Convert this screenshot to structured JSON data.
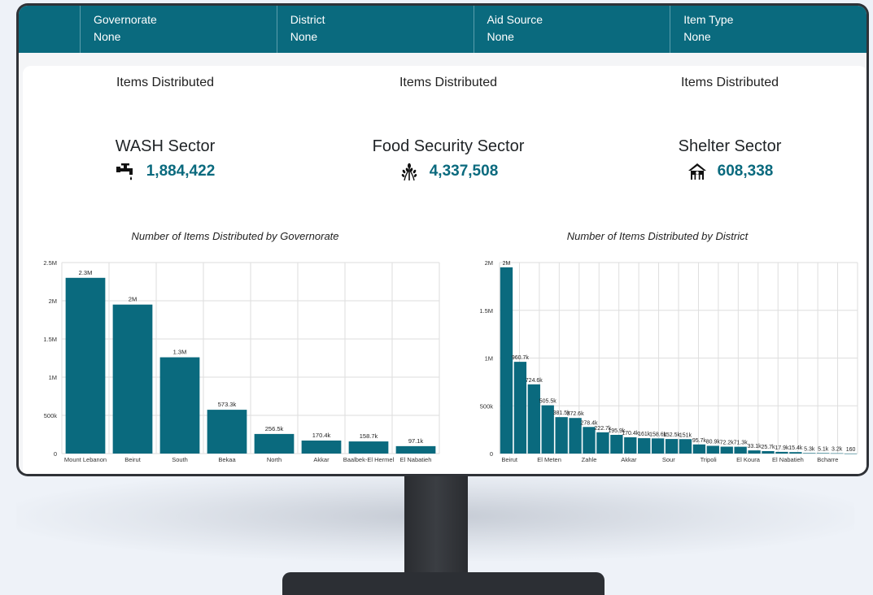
{
  "filters": [
    {
      "label": "Governorate",
      "value": "None"
    },
    {
      "label": "District",
      "value": "None"
    },
    {
      "label": "Aid Source",
      "value": "None"
    },
    {
      "label": "Item Type",
      "value": "None"
    }
  ],
  "kpis": [
    {
      "caption": "Items Distributed",
      "sector": "WASH Sector",
      "value": "1,884,422",
      "icon": "water-tap-icon"
    },
    {
      "caption": "Items Distributed",
      "sector": "Food Security Sector",
      "value": "4,337,508",
      "icon": "wheat-icon"
    },
    {
      "caption": "Items Distributed",
      "sector": "Shelter Sector",
      "value": "608,338",
      "icon": "shelter-house-icon"
    }
  ],
  "colors": {
    "accent": "#0a6a7e",
    "bar": "#0a6a7e"
  },
  "chart_data": [
    {
      "type": "bar",
      "title": "Number of Items Distributed by Governorate",
      "categories": [
        "Mount Lebanon",
        "Beirut",
        "South",
        "Bekaa",
        "North",
        "Akkar",
        "Baalbek-El Hermel",
        "El Nabatieh"
      ],
      "values": [
        2300000,
        1950000,
        1260000,
        573300,
        256500,
        170400,
        158700,
        97100
      ],
      "data_labels": [
        "2.3M",
        "2M",
        "1.3M",
        "573.3k",
        "256.5k",
        "170.4k",
        "158.7k",
        "97.1k"
      ],
      "yticks": [
        "0",
        "500k",
        "1M",
        "1.5M",
        "2M",
        "2.5M"
      ],
      "ylim": [
        0,
        2500000
      ],
      "grid": true
    },
    {
      "type": "bar",
      "title": "Number of Items Distributed by District",
      "categories": [
        "Beirut",
        "",
        "El Meten",
        "",
        "Zahle",
        "",
        "Akkar",
        "",
        "Sour",
        "",
        "Tripoli",
        "",
        "El Koura",
        "",
        "El Nabatieh",
        "",
        "Bcharre",
        ""
      ],
      "values": [
        1950000,
        960700,
        724600,
        505500,
        381500,
        372600,
        278400,
        222700,
        195900,
        170400,
        161000,
        158600,
        152500,
        151000,
        95700,
        80900,
        72200,
        71300,
        33100,
        25700,
        17900,
        15400,
        5300,
        5100,
        3200,
        160
      ],
      "data_labels": [
        "2M",
        "960.7k",
        "724.6k",
        "505.5k",
        "381.5k",
        "372.6k",
        "278.4k",
        "222.7k",
        "195.9k",
        "170.4k",
        "161k",
        "158.6k",
        "152.5k",
        "151k",
        "95.7k",
        "80.9k",
        "72.2k",
        "71.3k",
        "33.1k",
        "25.7k",
        "17.9k",
        "15.4k",
        "5.3k",
        "5.1k",
        "3.2k",
        "160"
      ],
      "xtick_labels": [
        "Beirut",
        "El Meten",
        "Zahle",
        "Akkar",
        "Sour",
        "Tripoli",
        "El Koura",
        "El Nabatieh",
        "Bcharre"
      ],
      "yticks": [
        "0",
        "500k",
        "1M",
        "1.5M",
        "2M"
      ],
      "ylim": [
        0,
        2000000
      ],
      "grid": true
    }
  ]
}
